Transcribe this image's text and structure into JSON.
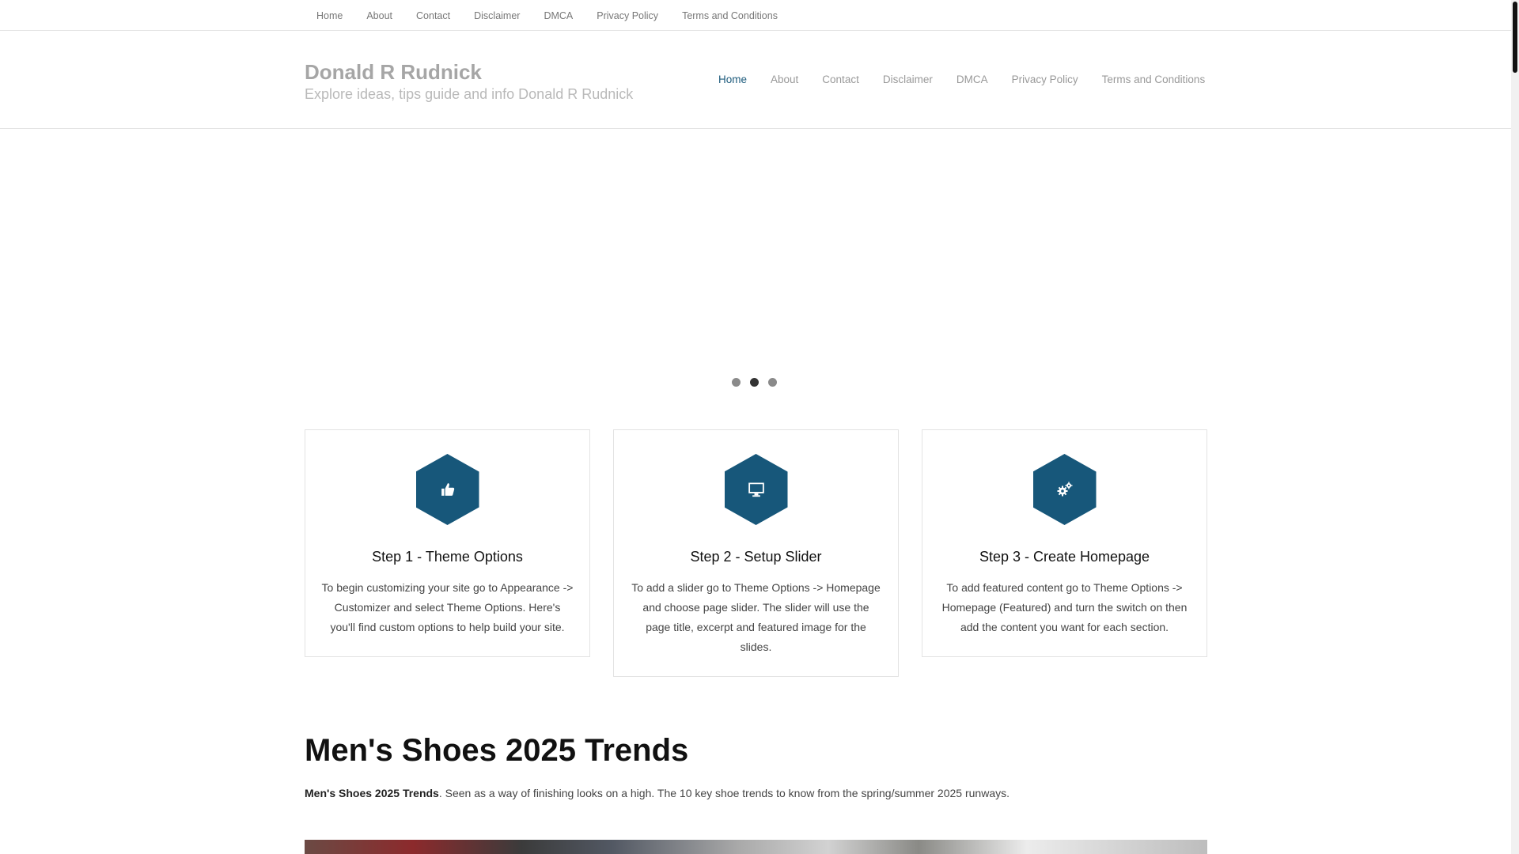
{
  "topbar": {
    "items": [
      "Home",
      "About",
      "Contact",
      "Disclaimer",
      "DMCA",
      "Privacy Policy",
      "Terms and Conditions"
    ]
  },
  "header": {
    "site_title": "Donald R Rudnick",
    "site_description": "Explore ideas, tips guide and info Donald R Rudnick",
    "nav": [
      "Home",
      "About",
      "Contact",
      "Disclaimer",
      "DMCA",
      "Privacy Policy",
      "Terms and Conditions"
    ],
    "active_nav": "Home"
  },
  "slider": {
    "slide_count": 3,
    "active_slide": 2
  },
  "cards": [
    {
      "icon": "thumbs-up-icon",
      "title": "Step 1 - Theme Options",
      "text": "To begin customizing your site go to Appearance -> Customizer and select Theme Options. Here's you'll find custom options to help build your site."
    },
    {
      "icon": "desktop-icon",
      "title": "Step 2 - Setup Slider",
      "text": "To add a slider go to Theme Options -> Homepage and choose page slider. The slider will use the page title, excerpt and featured image for the slides."
    },
    {
      "icon": "gears-icon",
      "title": "Step 3 - Create Homepage",
      "text": "To add featured content go to Theme Options -> Homepage (Featured) and turn the switch on then add the content you want for each section."
    }
  ],
  "article": {
    "title": "Men's Shoes 2025 Trends",
    "intro_bold": "Men's Shoes 2025 Trends",
    "intro_rest": ". Seen as a way of finishing looks on a high. The 10 key shoe trends to know from the spring/summer 2025 runways."
  },
  "colors": {
    "accent": "#17577a",
    "active_nav": "#1d5b7c",
    "title_gray": "#a6a6a6"
  }
}
